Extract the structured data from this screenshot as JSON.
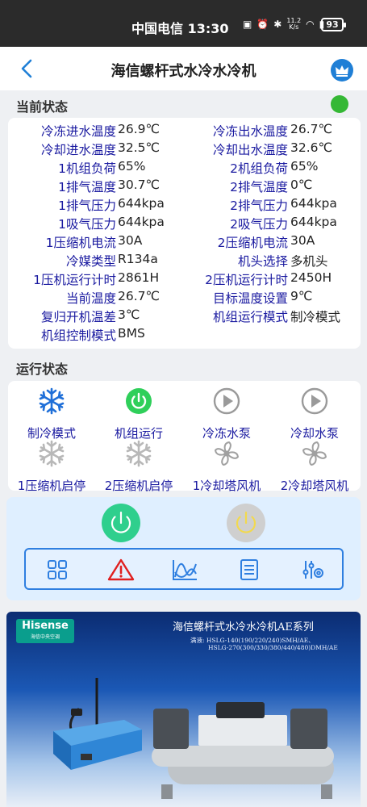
{
  "statusbar": {
    "carrier_time": "中国电信 13:30",
    "speed_top": "11.2",
    "speed_bottom": "K/s",
    "battery": "93"
  },
  "header": {
    "title": "海信螺杆式水冷水冷机"
  },
  "current_status": {
    "label": "当前状态",
    "rows": [
      {
        "l1": "冷冻进水温度",
        "v1": "26.9℃",
        "l2": "冷冻出水温度",
        "v2": "26.7℃"
      },
      {
        "l1": "冷却进水温度",
        "v1": "32.5℃",
        "l2": "冷却出水温度",
        "v2": "32.6℃"
      },
      {
        "l1": "1机组负荷",
        "v1": "65%",
        "l2": "2机组负荷",
        "v2": "65%"
      },
      {
        "l1": "1排气温度",
        "v1": "30.7℃",
        "l2": "2排气温度",
        "v2": "0℃"
      },
      {
        "l1": "1排气压力",
        "v1": "644kpa",
        "l2": "2排气压力",
        "v2": "644kpa"
      },
      {
        "l1": "1吸气压力",
        "v1": "644kpa",
        "l2": "2吸气压力",
        "v2": "644kpa"
      },
      {
        "l1": "1压缩机电流",
        "v1": "30A",
        "l2": "2压缩机电流",
        "v2": "30A"
      },
      {
        "l1": "冷媒类型",
        "v1": "R134a",
        "l2": "机头选择",
        "v2": "多机头"
      },
      {
        "l1": "1压机运行计时",
        "v1": "2861H",
        "l2": "2压机运行计时",
        "v2": "2450H"
      },
      {
        "l1": "当前温度",
        "v1": "26.7℃",
        "l2": "目标温度设置",
        "v2": "9℃"
      },
      {
        "l1": "复归开机温差",
        "v1": "3℃",
        "l2": "机组运行模式",
        "v2": "制冷模式"
      },
      {
        "l1": "机组控制模式",
        "v1": "BMS",
        "l2": "",
        "v2": ""
      }
    ]
  },
  "run_status": {
    "label": "运行状态",
    "items": [
      {
        "label": "制冷模式",
        "icon": "snowflake-icon",
        "color": "#1f6fd8"
      },
      {
        "label": "机组运行",
        "icon": "power-icon",
        "color": "#2fcf5a"
      },
      {
        "label": "冷冻水泵",
        "icon": "play-icon",
        "color": "#9a9a9a"
      },
      {
        "label": "冷却水泵",
        "icon": "play-icon",
        "color": "#9a9a9a"
      },
      {
        "label": "1压缩机启停",
        "icon": "snowflake-icon",
        "color": "#b8b8b8"
      },
      {
        "label": "2压缩机启停",
        "icon": "snowflake-icon",
        "color": "#b8b8b8"
      },
      {
        "label": "1冷却塔风机",
        "icon": "fan-icon",
        "color": "#a0a0a0"
      },
      {
        "label": "2冷却塔风机",
        "icon": "fan-icon",
        "color": "#a0a0a0"
      }
    ]
  },
  "banner": {
    "logo": "Hisense",
    "logo_sub": "海信中央空调",
    "title": "海信螺杆式水冷水冷机AE系列",
    "model_line1": "满液: HSLG-140(190/220/240)SMH/AE、",
    "model_line2": "HSLG-270(300/330/380/440/480)DMH/AE"
  },
  "colors": {
    "accent": "#1f7fd6",
    "label_blue": "#1a1aa0",
    "status_on": "#35b835"
  }
}
